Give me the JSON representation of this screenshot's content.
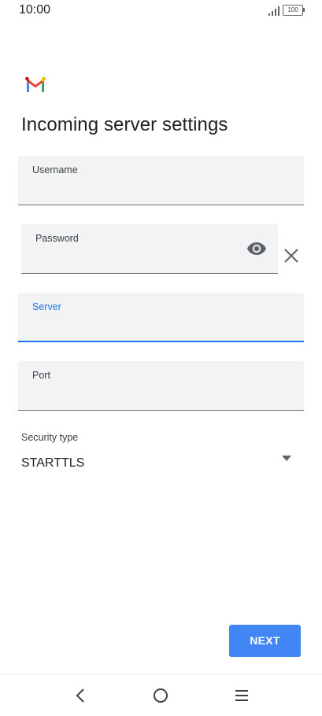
{
  "status_bar": {
    "time": "10:00",
    "battery": "100"
  },
  "app": {
    "logo_icon": "gmail-logo-icon"
  },
  "page": {
    "title": "Incoming server settings"
  },
  "form": {
    "username": {
      "label": "Username",
      "value": ""
    },
    "password": {
      "label": "Password",
      "value": ""
    },
    "server": {
      "label": "Server",
      "value": ""
    },
    "port": {
      "label": "Port",
      "value": ""
    },
    "security": {
      "label": "Security type",
      "value": "STARTTLS"
    }
  },
  "actions": {
    "next_label": "NEXT"
  },
  "nav": {
    "back_icon": "back-chevron-icon",
    "home_icon": "home-circle-icon",
    "menu_icon": "menu-lines-icon"
  },
  "colors": {
    "accent": "#1a73e8",
    "button": "#4285f4",
    "field_bg": "#f1f3f4"
  }
}
